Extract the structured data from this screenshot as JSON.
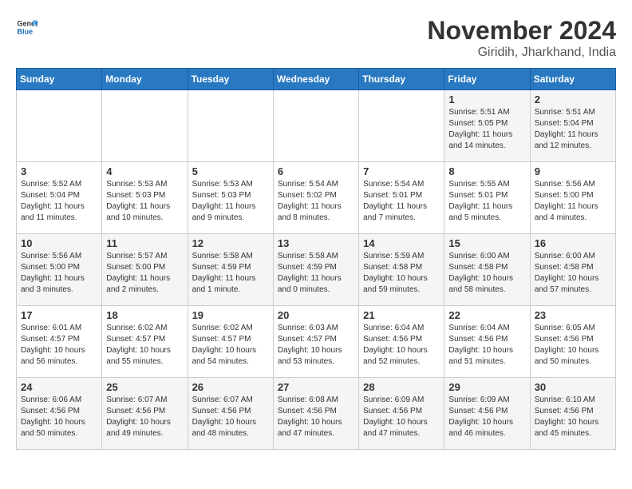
{
  "header": {
    "logo_general": "General",
    "logo_blue": "Blue",
    "month_title": "November 2024",
    "location": "Giridih, Jharkhand, India"
  },
  "days_of_week": [
    "Sunday",
    "Monday",
    "Tuesday",
    "Wednesday",
    "Thursday",
    "Friday",
    "Saturday"
  ],
  "weeks": [
    [
      {
        "day": "",
        "info": ""
      },
      {
        "day": "",
        "info": ""
      },
      {
        "day": "",
        "info": ""
      },
      {
        "day": "",
        "info": ""
      },
      {
        "day": "",
        "info": ""
      },
      {
        "day": "1",
        "info": "Sunrise: 5:51 AM\nSunset: 5:05 PM\nDaylight: 11 hours\nand 14 minutes."
      },
      {
        "day": "2",
        "info": "Sunrise: 5:51 AM\nSunset: 5:04 PM\nDaylight: 11 hours\nand 12 minutes."
      }
    ],
    [
      {
        "day": "3",
        "info": "Sunrise: 5:52 AM\nSunset: 5:04 PM\nDaylight: 11 hours\nand 11 minutes."
      },
      {
        "day": "4",
        "info": "Sunrise: 5:53 AM\nSunset: 5:03 PM\nDaylight: 11 hours\nand 10 minutes."
      },
      {
        "day": "5",
        "info": "Sunrise: 5:53 AM\nSunset: 5:03 PM\nDaylight: 11 hours\nand 9 minutes."
      },
      {
        "day": "6",
        "info": "Sunrise: 5:54 AM\nSunset: 5:02 PM\nDaylight: 11 hours\nand 8 minutes."
      },
      {
        "day": "7",
        "info": "Sunrise: 5:54 AM\nSunset: 5:01 PM\nDaylight: 11 hours\nand 7 minutes."
      },
      {
        "day": "8",
        "info": "Sunrise: 5:55 AM\nSunset: 5:01 PM\nDaylight: 11 hours\nand 5 minutes."
      },
      {
        "day": "9",
        "info": "Sunrise: 5:56 AM\nSunset: 5:00 PM\nDaylight: 11 hours\nand 4 minutes."
      }
    ],
    [
      {
        "day": "10",
        "info": "Sunrise: 5:56 AM\nSunset: 5:00 PM\nDaylight: 11 hours\nand 3 minutes."
      },
      {
        "day": "11",
        "info": "Sunrise: 5:57 AM\nSunset: 5:00 PM\nDaylight: 11 hours\nand 2 minutes."
      },
      {
        "day": "12",
        "info": "Sunrise: 5:58 AM\nSunset: 4:59 PM\nDaylight: 11 hours\nand 1 minute."
      },
      {
        "day": "13",
        "info": "Sunrise: 5:58 AM\nSunset: 4:59 PM\nDaylight: 11 hours\nand 0 minutes."
      },
      {
        "day": "14",
        "info": "Sunrise: 5:59 AM\nSunset: 4:58 PM\nDaylight: 10 hours\nand 59 minutes."
      },
      {
        "day": "15",
        "info": "Sunrise: 6:00 AM\nSunset: 4:58 PM\nDaylight: 10 hours\nand 58 minutes."
      },
      {
        "day": "16",
        "info": "Sunrise: 6:00 AM\nSunset: 4:58 PM\nDaylight: 10 hours\nand 57 minutes."
      }
    ],
    [
      {
        "day": "17",
        "info": "Sunrise: 6:01 AM\nSunset: 4:57 PM\nDaylight: 10 hours\nand 56 minutes."
      },
      {
        "day": "18",
        "info": "Sunrise: 6:02 AM\nSunset: 4:57 PM\nDaylight: 10 hours\nand 55 minutes."
      },
      {
        "day": "19",
        "info": "Sunrise: 6:02 AM\nSunset: 4:57 PM\nDaylight: 10 hours\nand 54 minutes."
      },
      {
        "day": "20",
        "info": "Sunrise: 6:03 AM\nSunset: 4:57 PM\nDaylight: 10 hours\nand 53 minutes."
      },
      {
        "day": "21",
        "info": "Sunrise: 6:04 AM\nSunset: 4:56 PM\nDaylight: 10 hours\nand 52 minutes."
      },
      {
        "day": "22",
        "info": "Sunrise: 6:04 AM\nSunset: 4:56 PM\nDaylight: 10 hours\nand 51 minutes."
      },
      {
        "day": "23",
        "info": "Sunrise: 6:05 AM\nSunset: 4:56 PM\nDaylight: 10 hours\nand 50 minutes."
      }
    ],
    [
      {
        "day": "24",
        "info": "Sunrise: 6:06 AM\nSunset: 4:56 PM\nDaylight: 10 hours\nand 50 minutes."
      },
      {
        "day": "25",
        "info": "Sunrise: 6:07 AM\nSunset: 4:56 PM\nDaylight: 10 hours\nand 49 minutes."
      },
      {
        "day": "26",
        "info": "Sunrise: 6:07 AM\nSunset: 4:56 PM\nDaylight: 10 hours\nand 48 minutes."
      },
      {
        "day": "27",
        "info": "Sunrise: 6:08 AM\nSunset: 4:56 PM\nDaylight: 10 hours\nand 47 minutes."
      },
      {
        "day": "28",
        "info": "Sunrise: 6:09 AM\nSunset: 4:56 PM\nDaylight: 10 hours\nand 47 minutes."
      },
      {
        "day": "29",
        "info": "Sunrise: 6:09 AM\nSunset: 4:56 PM\nDaylight: 10 hours\nand 46 minutes."
      },
      {
        "day": "30",
        "info": "Sunrise: 6:10 AM\nSunset: 4:56 PM\nDaylight: 10 hours\nand 45 minutes."
      }
    ]
  ]
}
